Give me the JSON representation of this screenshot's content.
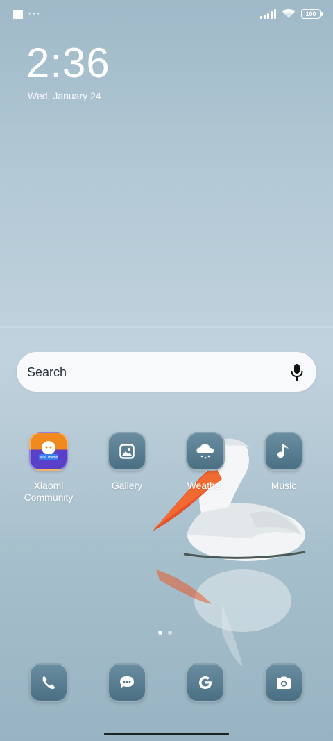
{
  "status_bar": {
    "notification_dots": "···",
    "battery_level": "100"
  },
  "clock": {
    "time": "2:36",
    "date": "Wed, January 24"
  },
  "search": {
    "placeholder": "Search"
  },
  "apps": [
    {
      "label": "Xiaomi Community",
      "icon": "xiaomi-community-icon"
    },
    {
      "label": "Gallery",
      "icon": "gallery-icon"
    },
    {
      "label": "Weather",
      "icon": "weather-icon"
    },
    {
      "label": "Music",
      "icon": "music-icon"
    }
  ],
  "dock": [
    {
      "icon": "phone-icon"
    },
    {
      "icon": "messages-icon"
    },
    {
      "icon": "google-icon"
    },
    {
      "icon": "camera-icon"
    }
  ],
  "page_indicator": {
    "pages": 2,
    "active": 1
  },
  "colors": {
    "icon_bg": "#56798d",
    "search_bg": "#f7f9fa",
    "community_orange": "#f08a1e",
    "community_purple": "#5a3fc8"
  }
}
